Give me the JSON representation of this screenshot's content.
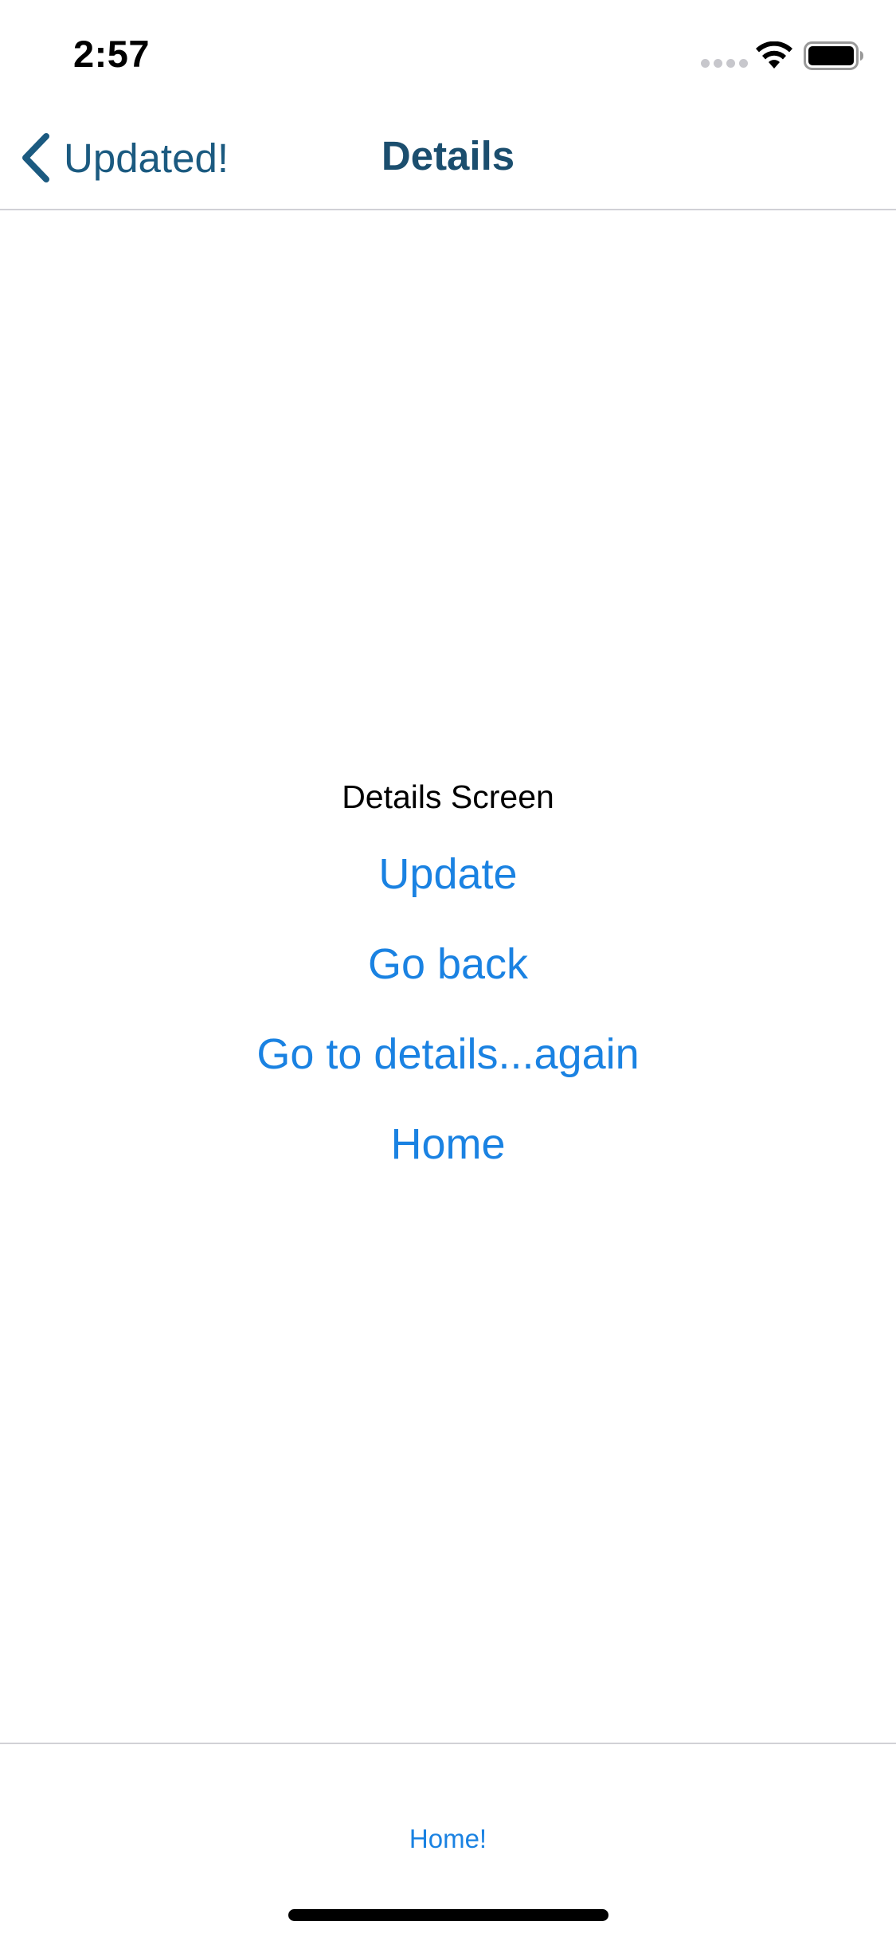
{
  "status_bar": {
    "time": "2:57"
  },
  "nav_bar": {
    "back_label": "Updated!",
    "title": "Details"
  },
  "main": {
    "screen_label": "Details Screen",
    "buttons": [
      {
        "label": "Update"
      },
      {
        "label": "Go back"
      },
      {
        "label": "Go to details...again"
      },
      {
        "label": "Home"
      }
    ]
  },
  "tab_bar": {
    "home_label": "Home!"
  },
  "colors": {
    "link_blue": "#1a82e2",
    "nav_title": "#1b4e6e",
    "back_tint": "#1b5a80"
  }
}
